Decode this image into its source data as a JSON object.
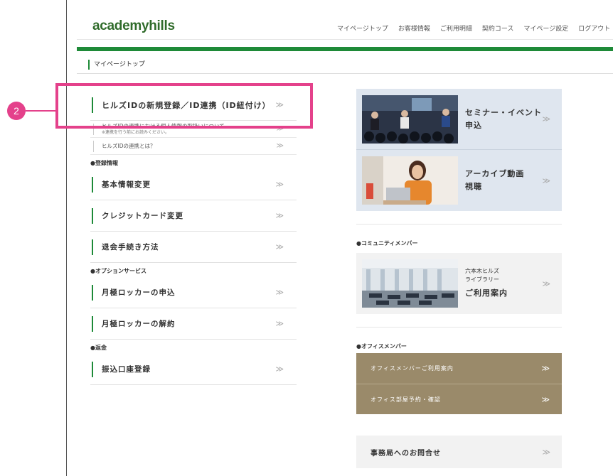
{
  "annotation": {
    "badge": "2"
  },
  "header": {
    "logo": "academyhills",
    "nav": [
      "マイページトップ",
      "お客様情報",
      "ご利用明細",
      "契約コース",
      "マイページ設定",
      "ログアウト"
    ]
  },
  "page_title": "マイページトップ",
  "left_menu": {
    "link_id": {
      "label": "ヒルズIDの新規登録／ID連携（ID紐付け）",
      "arrow": "≫"
    },
    "sub_items": [
      {
        "label": "ヒルズIDの連携における個人情報の取扱いについて",
        "note": "※連携を行う前にお読みください。",
        "arrow": "≫"
      },
      {
        "label": "ヒルズIDの連携とは？",
        "arrow": "≫"
      }
    ],
    "sections": [
      {
        "heading": "●登録情報",
        "items": [
          {
            "label": "基本情報変更",
            "arrow": "≫"
          },
          {
            "label": "クレジットカード変更",
            "arrow": "≫"
          },
          {
            "label": "退会手続き方法",
            "arrow": "≫"
          }
        ]
      },
      {
        "heading": "●オプションサービス",
        "items": [
          {
            "label": "月極ロッカーの申込",
            "arrow": "≫"
          },
          {
            "label": "月極ロッカーの解約",
            "arrow": "≫"
          }
        ]
      },
      {
        "heading": "●返金",
        "items": [
          {
            "label": "振込口座登録",
            "arrow": "≫"
          }
        ]
      }
    ]
  },
  "right_col": {
    "seminar": {
      "line1": "セミナー・イベント",
      "line2": "申込",
      "arrow": "≫"
    },
    "archive": {
      "line1": "アーカイブ動画",
      "line2": "視聴",
      "arrow": "≫"
    },
    "community": {
      "heading": "●コミュニティメンバー",
      "library": {
        "line1": "六本木ヒルズ",
        "line2": "ライブラリー",
        "line3": "ご利用案内",
        "arrow": "≫"
      }
    },
    "office": {
      "heading": "●オフィスメンバー",
      "guide": {
        "label": "オフィスメンバーご利用案内",
        "arrow": "≫"
      },
      "booking": {
        "label": "オフィス部屋予約・確認",
        "arrow": "≫"
      }
    },
    "contact": {
      "label": "事務局へのお問合せ",
      "arrow": "≫"
    }
  },
  "colors": {
    "accent_green": "#1e8a38",
    "annotation_pink": "#e4418b",
    "office_khaki": "#9a8a6a",
    "card_blue": "#dfe6ef"
  }
}
